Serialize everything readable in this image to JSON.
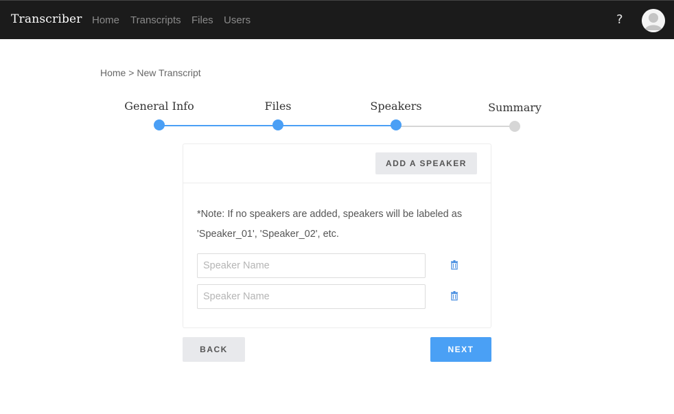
{
  "navbar": {
    "brand": "Transcriber",
    "links": [
      "Home",
      "Transcripts",
      "Files",
      "Users"
    ],
    "help_label": "?",
    "avatar_icon": "user-avatar-icon"
  },
  "breadcrumb": {
    "home": "Home",
    "separator": ">",
    "current": "New Transcript"
  },
  "stepper": {
    "active_color": "#4a9ff5",
    "inactive_color": "#d6d6d6",
    "current_step": 3,
    "steps": [
      {
        "label": "General Info",
        "state": "complete"
      },
      {
        "label": "Files",
        "state": "complete"
      },
      {
        "label": "Speakers",
        "state": "current"
      },
      {
        "label": "Summary",
        "state": "pending"
      }
    ]
  },
  "speakers_card": {
    "add_button_label": "ADD A SPEAKER",
    "note": "*Note: If no speakers are added, speakers will be labeled as 'Speaker_01', 'Speaker_02', etc.",
    "inputs": [
      {
        "value": "",
        "placeholder": "Speaker Name",
        "delete_icon": "trash-icon"
      },
      {
        "value": "",
        "placeholder": "Speaker Name",
        "delete_icon": "trash-icon"
      }
    ]
  },
  "footer": {
    "back_label": "BACK",
    "next_label": "NEXT",
    "next_color": "#4aa0f5"
  }
}
